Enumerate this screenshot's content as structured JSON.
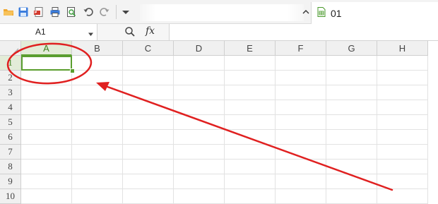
{
  "toolbar": {
    "icons": [
      "open-folder-icon",
      "save-icon",
      "export-pdf-icon",
      "print-icon",
      "print-preview-icon",
      "undo-icon",
      "redo-icon",
      "customize-dropdown-icon"
    ],
    "tab": {
      "label": "01",
      "icon": "spreadsheet-file-icon"
    }
  },
  "formula_bar": {
    "cell_reference": "A1",
    "zoom_icon": "zoom-icon",
    "fx_label": "fx",
    "formula_value": ""
  },
  "sheet": {
    "columns": [
      "A",
      "B",
      "C",
      "D",
      "E",
      "F",
      "G",
      "H"
    ],
    "rows": [
      "1",
      "2",
      "3",
      "4",
      "5",
      "6",
      "7",
      "8",
      "9",
      "10"
    ],
    "active_cell": "A1",
    "selection_color": "#5a9e2e"
  },
  "annotation": {
    "color": "#e02020",
    "shapes": [
      "circle-around-A1",
      "arrow-pointing-to-A1"
    ]
  }
}
